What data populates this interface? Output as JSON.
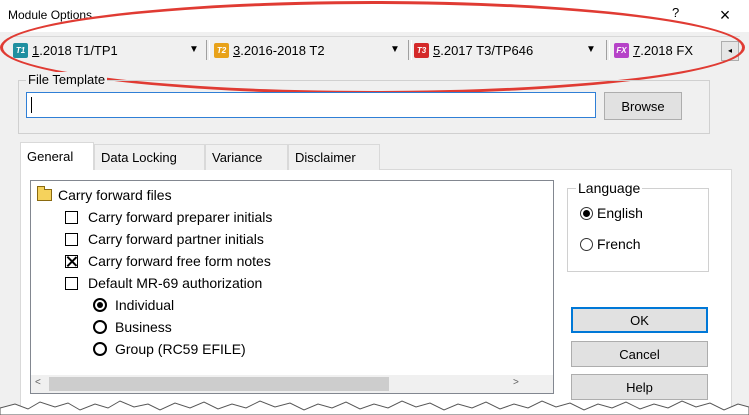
{
  "window": {
    "title": "Module Options",
    "help_glyph": "?",
    "close_glyph": "×"
  },
  "module_tabs": [
    {
      "icon": "T1",
      "icon_color": "#1f8fa0",
      "num": "1",
      "rest": ".2018 T1/TP1",
      "caret": "▼"
    },
    {
      "icon": "T2",
      "icon_color": "#e8a21a",
      "num": "3",
      "rest": ".2016-2018 T2",
      "caret": "▼"
    },
    {
      "icon": "T3",
      "icon_color": "#d42a2a",
      "num": "5",
      "rest": ".2017 T3/TP646",
      "caret": "▼"
    },
    {
      "icon": "FX",
      "icon_color": "#b642c8",
      "num": "7",
      "rest": ".2018 FX",
      "caret": ""
    }
  ],
  "scroll_left_glyph": "◂",
  "file_template": {
    "label": "File Template",
    "value": "",
    "browse_label": "Browse"
  },
  "tabs": [
    {
      "label": "General",
      "active": true
    },
    {
      "label": "Data Locking",
      "active": false
    },
    {
      "label": "Variance",
      "active": false
    },
    {
      "label": "Disclaimer",
      "active": false
    }
  ],
  "options_list": {
    "folder_label": "Carry forward files",
    "items": [
      {
        "label": "Carry forward preparer initials",
        "checked": false
      },
      {
        "label": "Carry forward partner initials",
        "checked": false
      },
      {
        "label": "Carry forward free form notes",
        "checked": true
      },
      {
        "label": "Default MR-69 authorization",
        "checked": false
      }
    ],
    "sub_radios": [
      {
        "label": "Individual",
        "selected": true
      },
      {
        "label": "Business",
        "selected": false
      },
      {
        "label": "Group (RC59 EFILE)",
        "selected": false
      }
    ],
    "scroll_up": "^",
    "scroll_down": "v",
    "scroll_left": "<",
    "scroll_right": ">"
  },
  "language": {
    "title": "Language",
    "options": [
      {
        "label": "English",
        "selected": true
      },
      {
        "label": "French",
        "selected": false
      }
    ]
  },
  "buttons": {
    "ok": "OK",
    "cancel": "Cancel",
    "help": "Help"
  },
  "colors": {
    "highlight_ellipse": "#e03b33",
    "focus_border": "#0078d7"
  }
}
